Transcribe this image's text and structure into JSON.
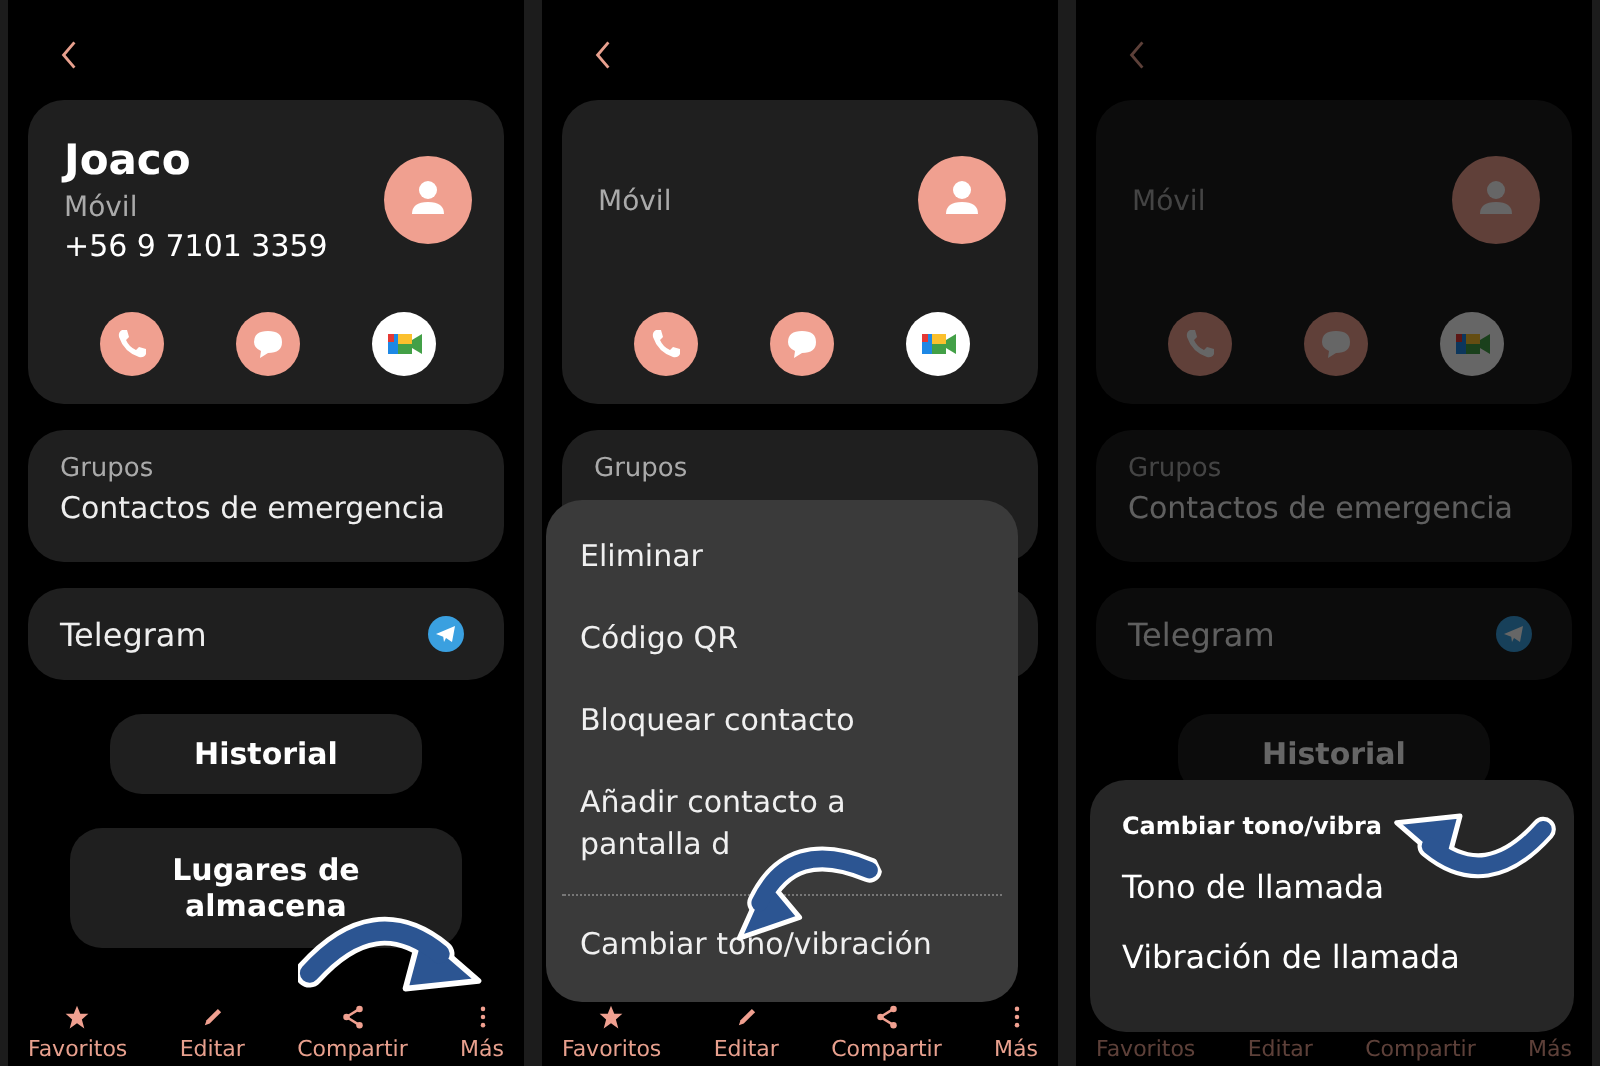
{
  "panels": [
    {
      "dimmed": false,
      "contact": {
        "name": "Joaco",
        "label": "Móvil",
        "number": "+56 9 7101 3359"
      },
      "groups": {
        "label": "Grupos",
        "value": "Contactos de emergencia"
      },
      "app": {
        "label": "Telegram"
      },
      "buttons": [
        {
          "lines": [
            "Historial"
          ]
        },
        {
          "lines": [
            "Lugares de",
            "almacena"
          ]
        }
      ],
      "nav": [
        {
          "label": "Favoritos",
          "kind": "star"
        },
        {
          "label": "Editar",
          "kind": "edit"
        },
        {
          "label": "Compartir",
          "kind": "share"
        },
        {
          "label": "Más",
          "kind": "more"
        }
      ],
      "annotation": {
        "kind": "arrow-down-right"
      }
    },
    {
      "dimmed": false,
      "contact": {
        "label": "Móvil"
      },
      "groups": {
        "label": "Grupos"
      },
      "nav": [
        {
          "label": "Favoritos",
          "kind": "star"
        },
        {
          "label": "Editar",
          "kind": "edit"
        },
        {
          "label": "Compartir",
          "kind": "share"
        },
        {
          "label": "Más",
          "kind": "more"
        }
      ],
      "annotation": {
        "kind": "arrow-down-left"
      },
      "overlay": {
        "kind": "popup-menu",
        "items": [
          {
            "lines": [
              "Eliminar"
            ]
          },
          {
            "lines": [
              "Código QR"
            ]
          },
          {
            "lines": [
              "Bloquear contacto"
            ]
          },
          {
            "lines": [
              "Añadir contacto a",
              "pantalla d"
            ]
          },
          {
            "lines": [
              "Cambiar tono/vibración"
            ],
            "divider_before": true
          }
        ]
      }
    },
    {
      "dimmed": true,
      "contact": {
        "label": "Móvil"
      },
      "groups": {
        "label": "Grupos",
        "value": "Contactos de emergencia"
      },
      "app": {
        "label": "Telegram"
      },
      "buttons": [
        {
          "lines": [
            "Historial"
          ]
        }
      ],
      "nav": [
        {
          "label": "Favoritos"
        },
        {
          "label": "Editar"
        },
        {
          "label": "Compartir"
        },
        {
          "label": "Más"
        }
      ],
      "annotation": {
        "kind": "arrow-left"
      },
      "overlay": {
        "kind": "bottom-sheet",
        "title": "Cambiar tono/vibra",
        "items": [
          {
            "lines": [
              "Tono de llamada"
            ]
          },
          {
            "lines": [
              "Vibración de llamada"
            ]
          }
        ]
      }
    }
  ]
}
